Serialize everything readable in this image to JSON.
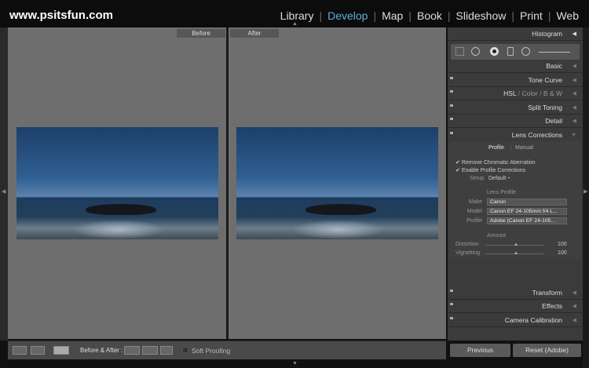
{
  "header": {
    "logo": "www.psitsfun.com",
    "modules": [
      "Library",
      "Develop",
      "Map",
      "Book",
      "Slideshow",
      "Print",
      "Web"
    ],
    "active": "Develop"
  },
  "view": {
    "before_label": "Before",
    "after_label": "After"
  },
  "panel": {
    "sections": [
      "Histogram",
      "Basic",
      "Tone Curve",
      "HSL",
      "Color",
      "B & W",
      "Split Toning",
      "Detail",
      "Lens Corrections"
    ],
    "lens": {
      "tabs": [
        "Profile",
        "Manual"
      ],
      "checks": [
        "Remove Chromatic Aberration",
        "Enable Profile Corrections"
      ],
      "setup_label": "Setup",
      "setup_value": "Default",
      "lens_profile_title": "Lens Profile",
      "make_label": "Make",
      "make_value": "Canon",
      "model_label": "Model",
      "model_value": "Canon EF 24-105mm f/4 L...",
      "profile_label": "Profile",
      "profile_value": "Adobe (Canon EF 24-105...",
      "amount_title": "Amount",
      "distortion_label": "Distortion",
      "distortion_value": "100",
      "vignetting_label": "Vignetting",
      "vignetting_value": "100"
    },
    "sections_after": [
      "Transform",
      "Effects",
      "Camera Calibration"
    ]
  },
  "toolbar": {
    "ba_label": "Before & After :",
    "soft_proofing": "Soft Proofing"
  },
  "buttons": {
    "previous": "Previous",
    "reset": "Reset (Adobe)"
  }
}
